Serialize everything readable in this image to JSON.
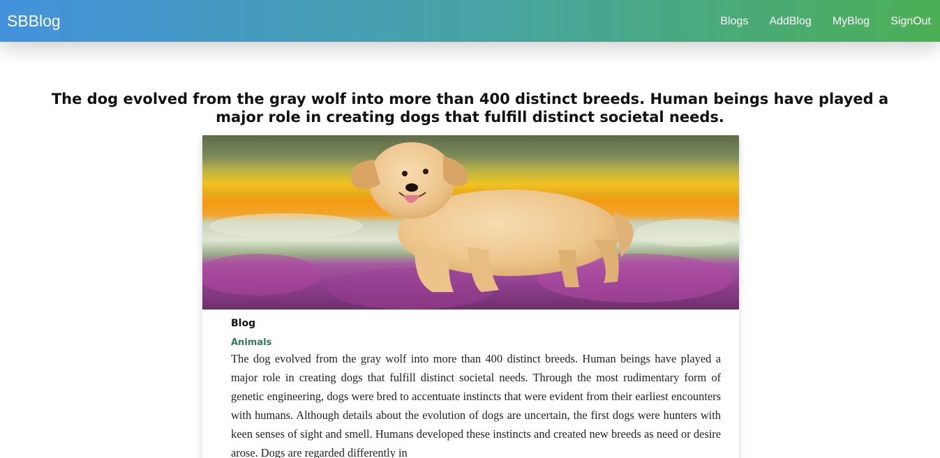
{
  "navbar": {
    "brand": "SBBlog",
    "links": [
      "Blogs",
      "AddBlog",
      "MyBlog",
      "SignOut"
    ],
    "gradient_colors": [
      "#4392dc",
      "#4caf55"
    ]
  },
  "headline": "The dog evolved from the gray wolf into more than 400 distinct breeds. Human beings have played a major role in creating dogs that fulfill distinct societal needs.",
  "blog_card": {
    "image": "golden-retriever-in-flower-field-photo",
    "title": "Blog",
    "category": "Animals",
    "category_color": "#2e7d52",
    "body": "The dog evolved from the gray wolf into more than 400 distinct breeds. Human beings have played a major role in creating dogs that fulfill distinct societal needs. Through the most rudimentary form of genetic engineering, dogs were bred to accentuate instincts that were evident from their earliest encounters with humans. Although details about the evolution of dogs are uncertain, the first dogs were hunters with keen senses of sight and smell. Humans developed these instincts and created new breeds as need or desire arose. Dogs are regarded differently in"
  }
}
